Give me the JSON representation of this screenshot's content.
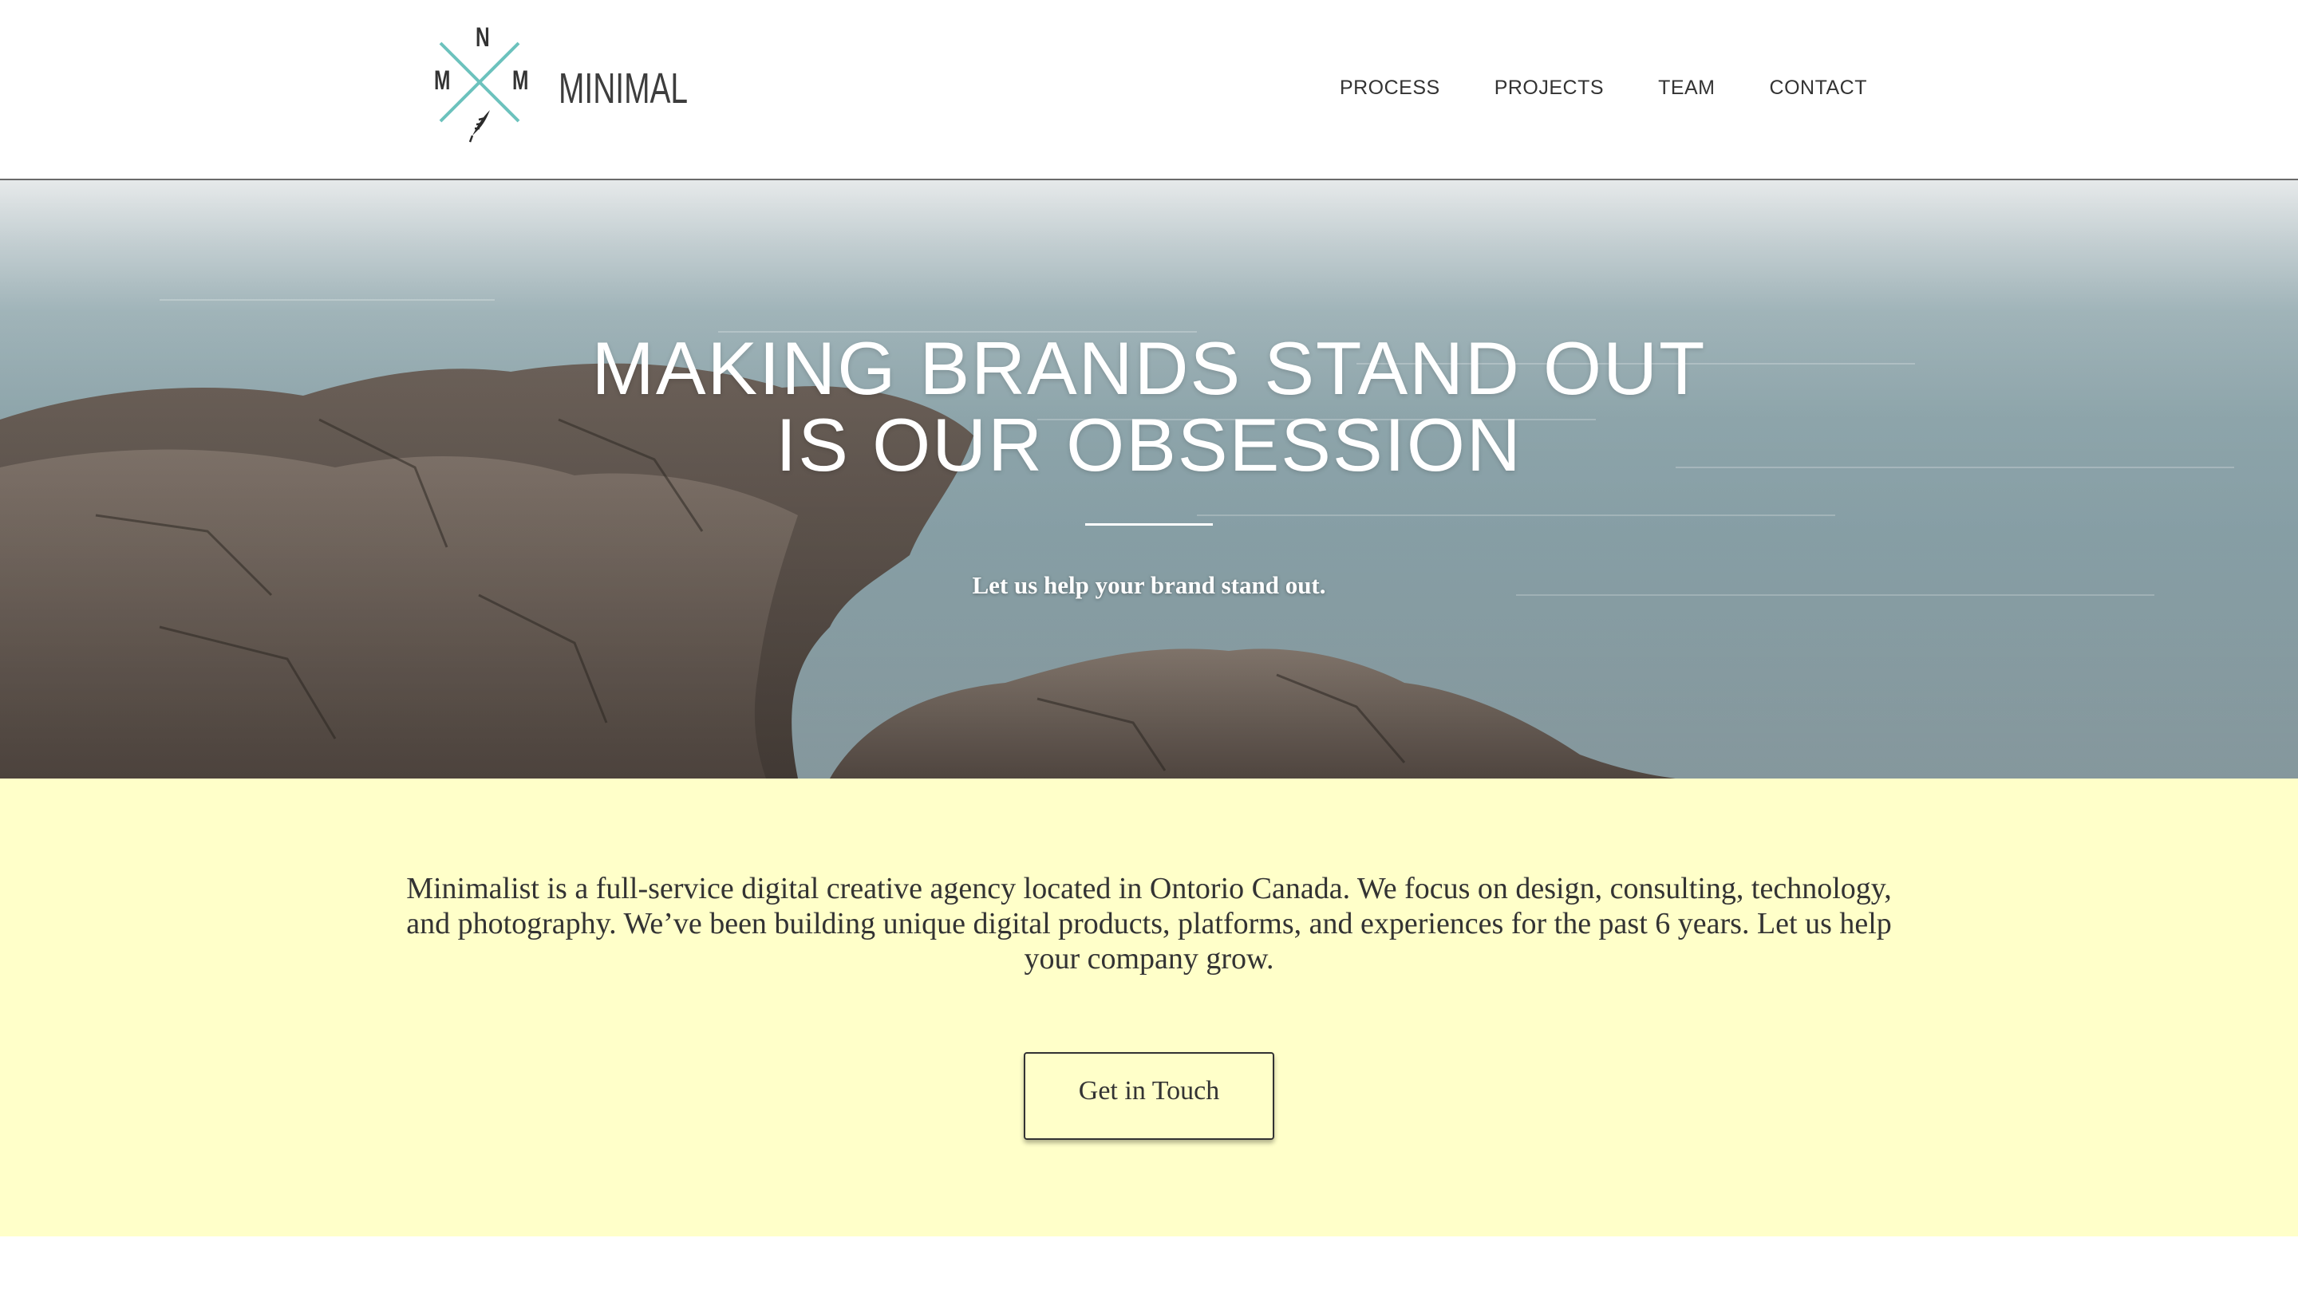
{
  "brand": {
    "logo_letters": {
      "top": "N",
      "left": "M",
      "right": "M"
    },
    "name": "MINIMAL",
    "accent_color": "#6cc2bd"
  },
  "nav": {
    "items": [
      {
        "label": "PROCESS"
      },
      {
        "label": "PROJECTS"
      },
      {
        "label": "TEAM"
      },
      {
        "label": "CONTACT"
      }
    ]
  },
  "hero": {
    "title_line1": "MAKING BRANDS STAND OUT",
    "title_line2": "IS OUR OBSESSION",
    "subtitle": "Let us help your brand stand out."
  },
  "intro": {
    "text": "Minimalist is a full-service digital creative agency located in Ontorio Canada. We focus on design, consulting, technology, and photography. We’ve been building unique digital products, platforms, and experiences for the past 6 years. Let us help your company grow.",
    "background_color": "#ffffc9",
    "cta_label": "Get in Touch"
  }
}
